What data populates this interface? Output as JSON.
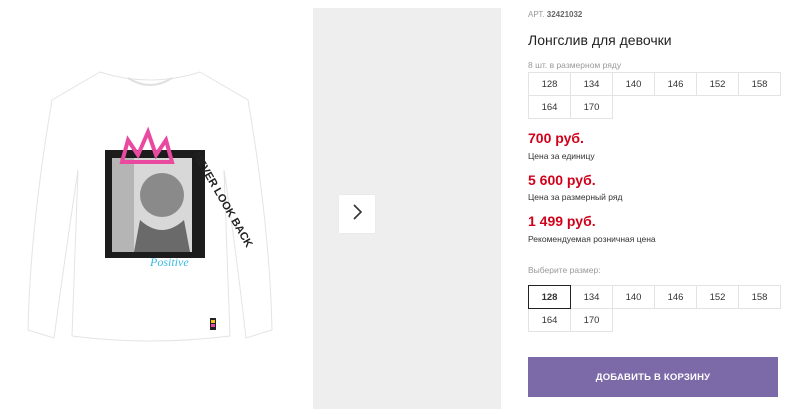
{
  "product": {
    "sku_label": "АРТ.",
    "sku_value": "32421032",
    "title": "Лонгслив для девочки",
    "pack_note": "8 шт. в размерном ряду",
    "print_text": "NEVER LOOK BACK",
    "print_script": "Positive"
  },
  "size_range": {
    "rows": [
      [
        "128",
        "134",
        "140",
        "146",
        "152",
        "158"
      ],
      [
        "164",
        "170"
      ]
    ]
  },
  "prices": {
    "unit_price": "700 руб.",
    "unit_label": "Цена за единицу",
    "set_price": "5 600 руб.",
    "set_label": "Цена за размерный ряд",
    "retail_price": "1 499 руб.",
    "retail_label": "Рекомендуемая розничная цена"
  },
  "size_picker": {
    "label": "Выберите размер:",
    "selected": "128",
    "rows": [
      [
        "128",
        "134",
        "140",
        "146",
        "152",
        "158"
      ],
      [
        "164",
        "170"
      ]
    ]
  },
  "actions": {
    "add_to_cart": "ДОБАВИТЬ В КОРЗИНУ"
  },
  "colors": {
    "price": "#d0021b",
    "button": "#7c6aa8",
    "crown": "#e94aa0",
    "script": "#39b9e2"
  },
  "icons": {
    "next": "chevron-right-icon"
  }
}
